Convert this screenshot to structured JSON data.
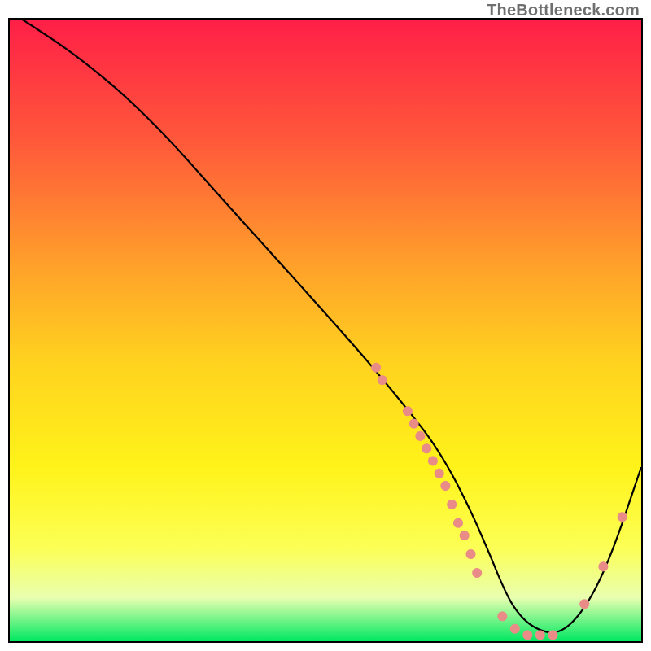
{
  "watermark": "TheBottleneck.com",
  "chart_data": {
    "type": "line",
    "title": "",
    "xlabel": "",
    "ylabel": "",
    "xlim": [
      0,
      100
    ],
    "ylim": [
      0,
      100
    ],
    "background_gradient": {
      "stops": [
        {
          "offset": 0,
          "color": "#ff1f47"
        },
        {
          "offset": 20,
          "color": "#ff5a3a"
        },
        {
          "offset": 40,
          "color": "#ffa22a"
        },
        {
          "offset": 55,
          "color": "#ffd21f"
        },
        {
          "offset": 72,
          "color": "#fff31a"
        },
        {
          "offset": 85,
          "color": "#fcff55"
        },
        {
          "offset": 93,
          "color": "#e9ffb0"
        },
        {
          "offset": 100,
          "color": "#00e861"
        }
      ]
    },
    "series": [
      {
        "name": "bottleneck-curve",
        "color": "#000000",
        "x": [
          2,
          5,
          8,
          12,
          18,
          25,
          32,
          40,
          48,
          55,
          60,
          64,
          67,
          70,
          73,
          76,
          78,
          80,
          83,
          87,
          91,
          95,
          100
        ],
        "y": [
          100,
          98,
          96,
          93,
          88,
          81,
          73,
          64,
          55,
          47,
          41,
          36,
          32,
          27,
          21,
          14,
          9,
          5,
          2,
          1,
          5,
          13,
          28
        ]
      }
    ],
    "markers": {
      "name": "sample-points",
      "color": "#e98b86",
      "radius": 6,
      "points": [
        {
          "x": 58,
          "y": 44
        },
        {
          "x": 59,
          "y": 42
        },
        {
          "x": 63,
          "y": 37
        },
        {
          "x": 64,
          "y": 35
        },
        {
          "x": 65,
          "y": 33
        },
        {
          "x": 66,
          "y": 31
        },
        {
          "x": 67,
          "y": 29
        },
        {
          "x": 68,
          "y": 27
        },
        {
          "x": 69,
          "y": 25
        },
        {
          "x": 70,
          "y": 22
        },
        {
          "x": 71,
          "y": 19
        },
        {
          "x": 72,
          "y": 17
        },
        {
          "x": 73,
          "y": 14
        },
        {
          "x": 74,
          "y": 11
        },
        {
          "x": 78,
          "y": 4
        },
        {
          "x": 80,
          "y": 2
        },
        {
          "x": 82,
          "y": 1
        },
        {
          "x": 84,
          "y": 1
        },
        {
          "x": 86,
          "y": 1
        },
        {
          "x": 91,
          "y": 6
        },
        {
          "x": 94,
          "y": 12
        },
        {
          "x": 97,
          "y": 20
        }
      ]
    }
  }
}
